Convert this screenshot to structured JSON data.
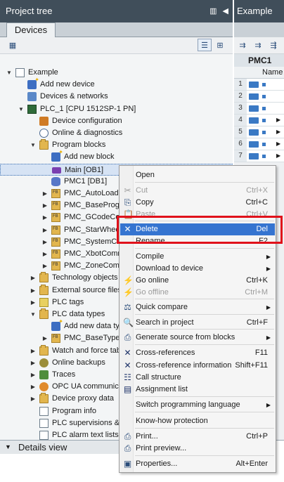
{
  "tree_panel": {
    "title": "Project tree",
    "tab": "Devices"
  },
  "tree": [
    {
      "label": "Example",
      "toggle": "open"
    },
    {
      "label": "Add new device",
      "toggle": ""
    },
    {
      "label": "Devices & networks",
      "toggle": ""
    },
    {
      "label": "PLC_1 [CPU 1512SP-1 PN]",
      "toggle": "open"
    },
    {
      "label": "Device configuration",
      "toggle": ""
    },
    {
      "label": "Online & diagnostics",
      "toggle": ""
    },
    {
      "label": "Program blocks",
      "toggle": "open"
    },
    {
      "label": "Add new block",
      "toggle": ""
    },
    {
      "label": "Main [OB1]",
      "toggle": ""
    },
    {
      "label": "PMC1 [DB1]",
      "toggle": ""
    },
    {
      "label": "PMC_AutoLoadin",
      "toggle": "closed"
    },
    {
      "label": "PMC_BaseProgra",
      "toggle": "closed"
    },
    {
      "label": "PMC_GCodeCo",
      "toggle": "closed"
    },
    {
      "label": "PMC_StarWhee",
      "toggle": "closed"
    },
    {
      "label": "PMC_SystemCon",
      "toggle": "closed"
    },
    {
      "label": "PMC_XbotComm",
      "toggle": "closed"
    },
    {
      "label": "PMC_ZoneComm",
      "toggle": "closed"
    },
    {
      "label": "Technology objects",
      "toggle": "closed"
    },
    {
      "label": "External source files",
      "toggle": "closed"
    },
    {
      "label": "PLC tags",
      "toggle": "closed"
    },
    {
      "label": "PLC data types",
      "toggle": "open"
    },
    {
      "label": "Add new data ty",
      "toggle": ""
    },
    {
      "label": "PMC_BaseTypes",
      "toggle": "closed"
    },
    {
      "label": "Watch and force tab",
      "toggle": "closed"
    },
    {
      "label": "Online backups",
      "toggle": "closed"
    },
    {
      "label": "Traces",
      "toggle": "closed"
    },
    {
      "label": "OPC UA communica",
      "toggle": "closed"
    },
    {
      "label": "Device proxy data",
      "toggle": "closed"
    },
    {
      "label": "Program info",
      "toggle": ""
    },
    {
      "label": "PLC supervisions &",
      "toggle": ""
    },
    {
      "label": "PLC alarm text lists",
      "toggle": ""
    }
  ],
  "details_view": {
    "label": "Details view"
  },
  "right_panel": {
    "title": "Example",
    "block_name": "PMC1",
    "column_name": "Name",
    "row_numbers": [
      "1",
      "2",
      "3",
      "4",
      "5",
      "6",
      "7"
    ]
  },
  "context_menu": {
    "items": [
      {
        "label": "Open",
        "shortcut": "",
        "icon": "",
        "disabled": false,
        "submenu": false
      },
      {
        "label": "Cut",
        "shortcut": "Ctrl+X",
        "icon": "cut-icon",
        "disabled": true,
        "submenu": false
      },
      {
        "label": "Copy",
        "shortcut": "Ctrl+C",
        "icon": "copy-icon",
        "disabled": false,
        "submenu": false
      },
      {
        "label": "Paste",
        "shortcut": "Ctrl+V",
        "icon": "paste-icon",
        "disabled": true,
        "submenu": false
      },
      {
        "label": "Delete",
        "shortcut": "Del",
        "icon": "delete-icon",
        "disabled": false,
        "submenu": false,
        "highlighted": true
      },
      {
        "label": "Rename",
        "shortcut": "F2",
        "icon": "",
        "disabled": false,
        "submenu": false
      },
      {
        "label": "Compile",
        "shortcut": "",
        "icon": "",
        "disabled": false,
        "submenu": true
      },
      {
        "label": "Download to device",
        "shortcut": "",
        "icon": "",
        "disabled": false,
        "submenu": true
      },
      {
        "label": "Go online",
        "shortcut": "Ctrl+K",
        "icon": "go-online-icon",
        "disabled": false,
        "submenu": false
      },
      {
        "label": "Go offline",
        "shortcut": "Ctrl+M",
        "icon": "go-offline-icon",
        "disabled": true,
        "submenu": false
      },
      {
        "label": "Quick compare",
        "shortcut": "",
        "icon": "compare-icon",
        "disabled": false,
        "submenu": true
      },
      {
        "label": "Search in project",
        "shortcut": "Ctrl+F",
        "icon": "search-icon",
        "disabled": false,
        "submenu": false
      },
      {
        "label": "Generate source from blocks",
        "shortcut": "",
        "icon": "generate-source-icon",
        "disabled": false,
        "submenu": true
      },
      {
        "label": "Cross-references",
        "shortcut": "F11",
        "icon": "cross-reference-icon",
        "disabled": false,
        "submenu": false
      },
      {
        "label": "Cross-reference information",
        "shortcut": "Shift+F11",
        "icon": "cross-reference-info-icon",
        "disabled": false,
        "submenu": false
      },
      {
        "label": "Call structure",
        "shortcut": "",
        "icon": "call-structure-icon",
        "disabled": false,
        "submenu": false
      },
      {
        "label": "Assignment list",
        "shortcut": "",
        "icon": "assignment-list-icon",
        "disabled": false,
        "submenu": false
      },
      {
        "label": "Switch programming language",
        "shortcut": "",
        "icon": "",
        "disabled": false,
        "submenu": true
      },
      {
        "label": "Know-how protection",
        "shortcut": "",
        "icon": "",
        "disabled": false,
        "submenu": false
      },
      {
        "label": "Print...",
        "shortcut": "Ctrl+P",
        "icon": "print-icon",
        "disabled": false,
        "submenu": false
      },
      {
        "label": "Print preview...",
        "shortcut": "",
        "icon": "print-preview-icon",
        "disabled": false,
        "submenu": false
      },
      {
        "label": "Properties...",
        "shortcut": "Alt+Enter",
        "icon": "properties-icon",
        "disabled": false,
        "submenu": false
      }
    ]
  },
  "colors": {
    "header": "#404e5a",
    "selection": "#3574d0",
    "highlight_box": "#e0121b"
  }
}
